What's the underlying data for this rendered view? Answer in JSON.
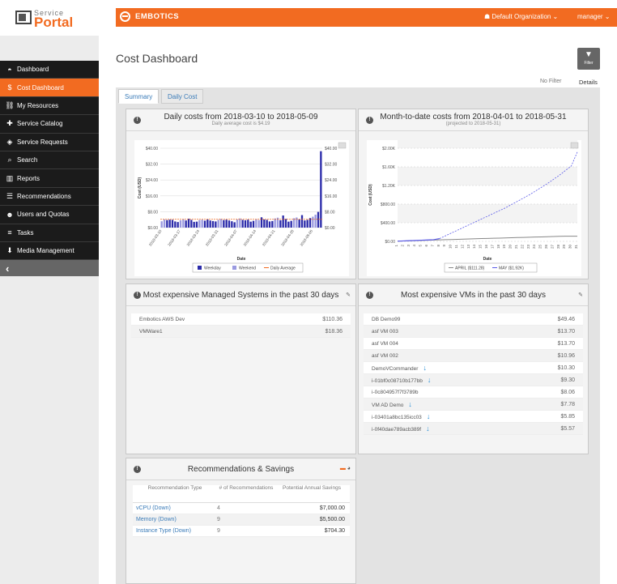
{
  "branding": {
    "service": "Service",
    "portal": "Portal",
    "product": "EMBOTICS"
  },
  "topbar": {
    "org": "Default Organization ⌄",
    "user": "manager ⌄"
  },
  "nav": {
    "items": [
      {
        "icon": "dashboard-icon",
        "glyph": "◓",
        "label": "Dashboard"
      },
      {
        "icon": "dollar-icon",
        "glyph": "$",
        "label": "Cost Dashboard"
      },
      {
        "icon": "resources-icon",
        "glyph": "⛓",
        "label": "My Resources"
      },
      {
        "icon": "plus-icon",
        "glyph": "✚",
        "label": "Service Catalog"
      },
      {
        "icon": "tag-icon",
        "glyph": "◈",
        "label": "Service Requests"
      },
      {
        "icon": "search-icon",
        "glyph": "⌕",
        "label": "Search"
      },
      {
        "icon": "bar-chart-icon",
        "glyph": "▥",
        "label": "Reports"
      },
      {
        "icon": "sliders-icon",
        "glyph": "☰",
        "label": "Recommendations"
      },
      {
        "icon": "users-icon",
        "glyph": "☻",
        "label": "Users and Quotas"
      },
      {
        "icon": "list-icon",
        "glyph": "≡",
        "label": "Tasks"
      },
      {
        "icon": "download-icon",
        "glyph": "⬇",
        "label": "Media Management"
      }
    ],
    "collapse": "‹"
  },
  "page": {
    "title": "Cost Dashboard",
    "filter_label": "Filter",
    "no_filter": "No Filter",
    "details": "Details"
  },
  "tabs": [
    "Summary",
    "Daily Cost"
  ],
  "daily": {
    "title": "Daily costs from 2018-03-10 to 2018-05-09",
    "subtitle": "Daily average cost is $4.19"
  },
  "mtd": {
    "title": "Month-to-date costs from 2018-04-01 to 2018-05-31",
    "subtitle": "(projected to 2018-05-31)"
  },
  "managed": {
    "title": "Most expensive Managed Systems in the past 30 days",
    "rows": [
      {
        "name": "Embotics AWS Dev",
        "value": "$110.36",
        "arrow": false
      },
      {
        "name": "VMWare1",
        "value": "$18.36",
        "arrow": false
      }
    ]
  },
  "vms": {
    "title": "Most expensive VMs in the past 30 days",
    "rows": [
      {
        "name": "DB Demo99",
        "value": "$49.46",
        "arrow": false
      },
      {
        "name": "asf VM 003",
        "value": "$13.70",
        "arrow": false
      },
      {
        "name": "asf VM 004",
        "value": "$13.70",
        "arrow": false
      },
      {
        "name": "asf VM 002",
        "value": "$10.96",
        "arrow": false
      },
      {
        "name": "DemoVCommander",
        "value": "$10.30",
        "arrow": true
      },
      {
        "name": "i-01bf0c08710b177bb",
        "value": "$9.30",
        "arrow": true
      },
      {
        "name": "i-0c804957f7f3789b",
        "value": "$8.06",
        "arrow": false
      },
      {
        "name": "VM AD Demo",
        "value": "$7.78",
        "arrow": true
      },
      {
        "name": "i-03401a8bc135icc03",
        "value": "$5.85",
        "arrow": true
      },
      {
        "name": "i-0f40dae789acb389f",
        "value": "$5.57",
        "arrow": true
      }
    ]
  },
  "recs": {
    "title": "Recommendations & Savings",
    "headers": [
      "Recommendation Type",
      "# of Recommendations",
      "Potential Annual Savings"
    ],
    "rows": [
      {
        "type": "vCPU (Down)",
        "count": "4",
        "savings": "$7,000.00"
      },
      {
        "type": "Memory (Down)",
        "count": "9",
        "savings": "$5,500.00"
      },
      {
        "type": "Instance Type (Down)",
        "count": "9",
        "savings": "$704.30"
      }
    ]
  },
  "colors": {
    "accent": "#f26b21",
    "nav_bg": "#1b1b1b",
    "weekday": "#2b2baa",
    "weekend": "#9a9ae0",
    "average": "#f26b21",
    "april": "#888888",
    "may": "#5a5ae8"
  },
  "chart_data": [
    {
      "type": "bar",
      "title": "Daily costs from 2018-03-10 to 2018-05-09",
      "subtitle": "Daily average cost is $4.19",
      "xlabel": "Date",
      "ylabel": "Cost (USD)",
      "ylim": [
        0,
        40
      ],
      "yticks": [
        "$0.00",
        "$8.00",
        "$16.00",
        "$24.00",
        "$32.00",
        "$40.00"
      ],
      "xticks": [
        "2018-03-10",
        "2018-03-17",
        "2018-03-24",
        "2018-03-31",
        "2018-04-07",
        "2018-04-14",
        "2018-04-21",
        "2018-04-28",
        "2018-05-05"
      ],
      "legend": [
        "Weekday",
        "Weekend",
        "Daily Average"
      ],
      "average": 4.19,
      "values": [
        3.2,
        4.1,
        3.8,
        4.0,
        3.9,
        3.1,
        2.8,
        3.7,
        4.3,
        3.6,
        4.5,
        3.9,
        2.9,
        3.0,
        3.8,
        4.0,
        3.5,
        4.2,
        3.6,
        3.3,
        3.1,
        3.9,
        4.4,
        3.8,
        4.0,
        3.6,
        3.2,
        2.7,
        4.1,
        4.6,
        3.9,
        3.7,
        4.0,
        3.0,
        3.4,
        4.2,
        3.8,
        5.2,
        4.1,
        3.9,
        3.1,
        3.3,
        4.6,
        5.0,
        3.7,
        6.1,
        4.4,
        3.0,
        3.4,
        4.7,
        5.1,
        4.2,
        6.3,
        3.6,
        3.9,
        4.8,
        5.5,
        6.5,
        7.9,
        38.5
      ],
      "weekend": [
        1,
        1,
        0,
        0,
        0,
        0,
        0,
        1,
        1,
        0,
        0,
        0,
        0,
        0,
        1,
        1,
        0,
        0,
        0,
        0,
        0,
        1,
        1,
        0,
        0,
        0,
        0,
        0,
        1,
        1,
        0,
        0,
        0,
        0,
        0,
        1,
        1,
        0,
        0,
        0,
        0,
        0,
        1,
        1,
        0,
        0,
        0,
        0,
        0,
        1,
        1,
        0,
        0,
        0,
        0,
        0,
        1,
        1,
        0,
        0
      ]
    },
    {
      "type": "line",
      "title": "Month-to-date costs from 2018-04-01 to 2018-05-31",
      "subtitle": "(projected to 2018-05-31)",
      "xlabel": "Date",
      "ylabel": "Cost (USD)",
      "ylim": [
        0,
        2000
      ],
      "yticks": [
        "$0.00",
        "$400.00",
        "$800.00",
        "$1.20K",
        "$1.60K",
        "$2.00K"
      ],
      "x": [
        1,
        2,
        3,
        4,
        5,
        6,
        7,
        8,
        9,
        10,
        11,
        12,
        13,
        14,
        15,
        16,
        17,
        18,
        19,
        20,
        21,
        22,
        23,
        24,
        25,
        26,
        27,
        28,
        29,
        30,
        31
      ],
      "series": [
        {
          "name": "APRIL ($111.28)",
          "values": [
            4,
            8,
            12,
            16,
            20,
            24,
            28,
            32,
            36,
            40,
            44,
            48,
            52,
            56,
            60,
            63,
            67,
            70,
            74,
            78,
            82,
            85,
            89,
            93,
            96,
            100,
            104,
            108,
            111,
            111,
            111
          ]
        },
        {
          "name": "MAY ($1.92K)",
          "values": [
            5,
            10,
            15,
            20,
            25,
            30,
            36,
            60,
            120,
            180,
            240,
            300,
            360,
            420,
            480,
            540,
            600,
            660,
            720,
            790,
            860,
            930,
            1000,
            1080,
            1160,
            1240,
            1330,
            1420,
            1520,
            1620,
            1920
          ],
          "projected_from": 8
        }
      ]
    }
  ]
}
